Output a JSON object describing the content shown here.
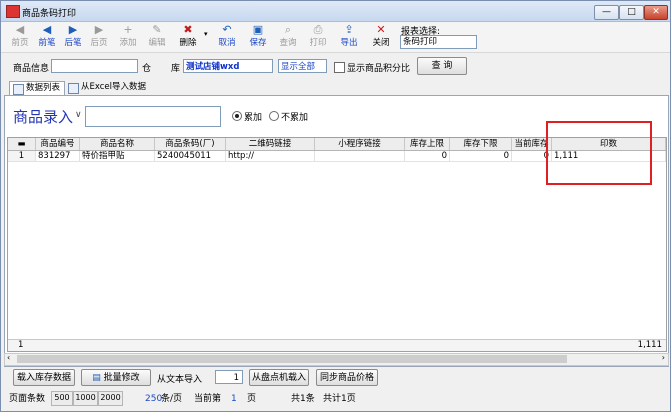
{
  "window": {
    "title": "商品条码打印",
    "controls": {
      "minimize": "—",
      "maximize": "□",
      "close": "✕"
    }
  },
  "toolbar": {
    "buttons": [
      {
        "name": "first-page-button",
        "icon": "◀",
        "label": "前页",
        "enabled": false
      },
      {
        "name": "prev-record-button",
        "icon": "◀",
        "label": "前笔",
        "enabled": true
      },
      {
        "name": "next-record-button",
        "icon": "▶",
        "label": "后笔",
        "enabled": true
      },
      {
        "name": "last-page-button",
        "icon": "▶",
        "label": "后页",
        "enabled": false
      },
      {
        "name": "add-button",
        "icon": "+",
        "label": "添加",
        "enabled": false
      },
      {
        "name": "edit-button",
        "icon": "✎",
        "label": "编辑",
        "enabled": false
      },
      {
        "name": "delete-button",
        "icon": "✖",
        "label": "删除",
        "enabled": true
      },
      {
        "name": "cancel-button",
        "icon": "↶",
        "label": "取消",
        "enabled": true
      },
      {
        "name": "save-button",
        "icon": "▣",
        "label": "保存",
        "enabled": true
      },
      {
        "name": "query-button",
        "icon": "⌕",
        "label": "查询",
        "enabled": false
      },
      {
        "name": "print-button",
        "icon": "⎙",
        "label": "打印",
        "enabled": false
      },
      {
        "name": "export-button",
        "icon": "⇪",
        "label": "导出",
        "enabled": true
      },
      {
        "name": "close-button",
        "icon": "✕",
        "label": "关闭",
        "enabled": true
      }
    ],
    "report_label": "报表选择:",
    "report_value": "条码打印"
  },
  "filter": {
    "product_label": "商品信息",
    "product_value": "",
    "warehouse_label": "仓",
    "store_label": "库",
    "store_value": "测试店铺wxd",
    "show_all": "显示全部",
    "show_points_label": "显示商品积分比",
    "search_button": "查 询"
  },
  "tabs": [
    "数据列表",
    "从Excel导入数据"
  ],
  "entry": {
    "title": "商品录入",
    "dropdown": "∨",
    "mode_accumulate": "累加",
    "mode_no_accumulate": "不累加"
  },
  "table": {
    "columns": [
      "商品编号",
      "商品名称",
      "商品条码(厂)",
      "二维码链接",
      "小程序链接",
      "库存上限",
      "库存下限",
      "当前库存",
      "印数"
    ],
    "rows": [
      {
        "index": "1",
        "code": "831297",
        "name": "特价指甲贴",
        "barcode": "5240045011",
        "qr": "http://",
        "mini": "",
        "upper": "0",
        "lower": "0",
        "current": "0",
        "copies": "1,111"
      }
    ],
    "footer_index": "1",
    "footer_total": "1,111"
  },
  "bottom": {
    "load_stock": "载入库存数据",
    "batch_edit": "批量修改",
    "import_text_label": "从文本导入",
    "import_text_value": "1",
    "load_counter": "从盘点机载入",
    "sync_price": "同步商品价格"
  },
  "status": {
    "page_size_label": "页面条数",
    "sizes": [
      "500",
      "1000",
      "2000"
    ],
    "per_page": "250",
    "per_page_unit": "条/页",
    "current_label": "当前第",
    "current_page": "1",
    "page_unit": "页",
    "total_records": "共1条",
    "total_pages": "共计1页"
  }
}
